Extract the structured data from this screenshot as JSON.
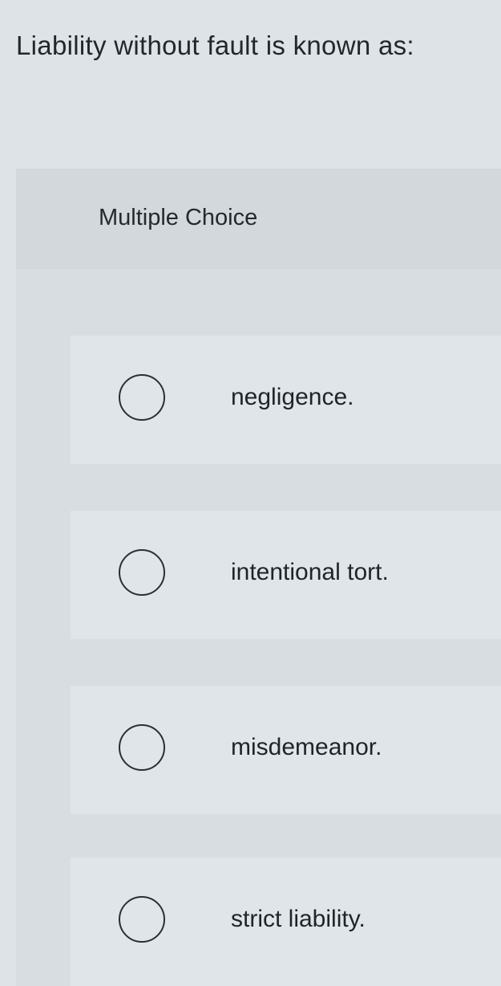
{
  "question": {
    "text": "Liability without fault is known as:"
  },
  "multiple_choice": {
    "label": "Multiple Choice",
    "options": [
      {
        "text": "negligence.",
        "selected": false
      },
      {
        "text": "intentional tort.",
        "selected": false
      },
      {
        "text": "misdemeanor.",
        "selected": false
      },
      {
        "text": "strict liability.",
        "selected": false
      }
    ]
  }
}
